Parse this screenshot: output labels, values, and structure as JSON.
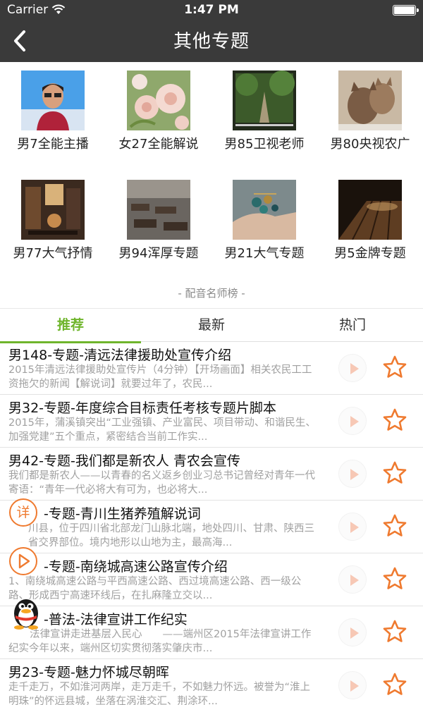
{
  "status_bar": {
    "carrier": "Carrier",
    "time": "1:47 PM"
  },
  "nav": {
    "title": "其他专题",
    "back_icon": "chevron-left-icon"
  },
  "topics": [
    {
      "label": "男7全能主播",
      "image": "man-portrait"
    },
    {
      "label": "女27全能解说",
      "image": "roses"
    },
    {
      "label": "男85卫视老师",
      "image": "forest-path"
    },
    {
      "label": "男80央视农广",
      "image": "cats"
    },
    {
      "label": "男77大气抒情",
      "image": "cafe-interior"
    },
    {
      "label": "男94浑厚专题",
      "image": "classroom"
    },
    {
      "label": "男21大气专题",
      "image": "hands-jewelry"
    },
    {
      "label": "男5金牌专题",
      "image": "wooden-floor"
    }
  ],
  "rank_caption": "- 配音名师榜 -",
  "tabs": [
    "推荐",
    "最新",
    "热门"
  ],
  "active_tab": 0,
  "accent": "#6fb52c",
  "orange": "#ef7a2f",
  "list": [
    {
      "title": "男148-专题-清远法律援助处宣传介绍",
      "desc": "2015年清远法律援助处宣传片（4分钟）【开场画面】相关农民工工资拖欠的新闻【解说词】就要过年了，农民..."
    },
    {
      "title": "男32-专题-年度综合目标责任考核专题片脚本",
      "desc": "2015年，蒲溪镇突出“工业强镇、产业富民、项目带动、和谐民生、加强党建”五个重点，紧密结合当前工作实..."
    },
    {
      "title": "男42-专题-我们都是新农人 青农会宣传",
      "desc": "我们都是新农人——以青春的名义返乡创业习总书记曾经对青年一代寄语：“青年一代必将大有可为，也必将大..."
    },
    {
      "title": "-专题-青川生猪养殖解说词",
      "desc": "川县，位于四川省北部龙门山脉北端，地处四川、甘肃、陕西三省交界部位。境内地形以山地为主，最高海..."
    },
    {
      "title": "-专题-南绕城高速公路宣传介绍",
      "desc": "1、南绕城高速公路与平西高速公路、西过境高速公路、西一级公路、形成西宁高速环线后，在扎麻隆立交以..."
    },
    {
      "title": "-普法-法律宣讲工作纪实",
      "desc": "法律宣讲走进基层入民心　　——端州区2015年法律宣讲工作纪实今年以来，端州区切实贯彻落实肇庆市..."
    },
    {
      "title": "男23-专题-魅力怀城尽朝晖",
      "desc": "走千走万，不如淮河两岸，走万走千，不如魅力怀远。被誉为“淮上明珠”的怀远县城，坐落在涡淮交汇、荆涂环..."
    }
  ],
  "floating": {
    "detail_label": "详"
  }
}
